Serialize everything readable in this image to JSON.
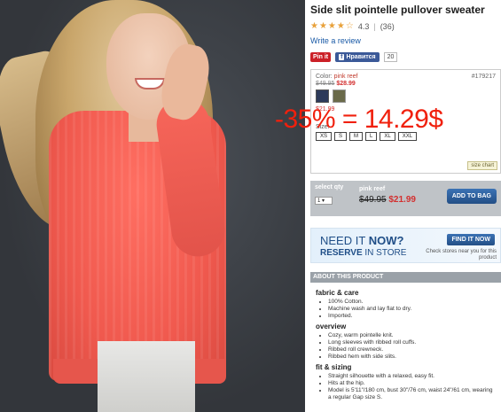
{
  "product": {
    "title": "Side slit pointelle pullover sweater",
    "stars": "★★★★☆",
    "rating": "4.3",
    "reviews": "(36)",
    "write_review": "Write a review"
  },
  "social": {
    "pinit": "Pin it",
    "fb_icon": "f",
    "like": "Нравится",
    "like_count": "20"
  },
  "options": {
    "color_label": "Color:",
    "color_value": "pink reef",
    "sku": "#179217",
    "orig_price": "$49.95",
    "sale_price": "$28.99",
    "size_price": "$21.99",
    "size_label": "Size:",
    "sizes": [
      "XS",
      "S",
      "M",
      "L",
      "XL",
      "XXL"
    ],
    "size_chart": "size chart"
  },
  "buy": {
    "qty_label": "select qty",
    "qty_value": "1 ▾",
    "color": "pink reef",
    "orig_price": "$49.95",
    "price": "$21.99",
    "add_to_bag": "ADD TO BAG"
  },
  "store": {
    "need": "NEED IT",
    "now": "NOW?",
    "reserve": "RESERVE",
    "in_store": "IN STORE",
    "find_btn": "FIND IT NOW",
    "near": "Check stores near you for this product"
  },
  "about": {
    "header": "ABOUT THIS PRODUCT",
    "sections": [
      {
        "title": "fabric & care",
        "items": [
          "100% Cotton.",
          "Machine wash and lay flat to dry.",
          "Imported."
        ]
      },
      {
        "title": "overview",
        "items": [
          "Cozy, warm pointelle knit.",
          "Long sleeves with ribbed roll cuffs.",
          "Ribbed roll crewneck.",
          "Ribbed hem with side slits."
        ]
      },
      {
        "title": "fit & sizing",
        "items": [
          "Straight silhouette with a relaxed, easy fit.",
          "Hits at the hip.",
          "Model is 5'11\"/180 cm, bust 30\"/76 cm, waist 24\"/61 cm, wearing a regular Gap size S."
        ]
      }
    ]
  },
  "overlay_text": "-35% = 14.29$",
  "colors": {
    "accent_blue": "#234f86",
    "sale_red": "#d32f2f",
    "overlay_red": "#f0200d",
    "sweater_coral": "#f0594e"
  }
}
